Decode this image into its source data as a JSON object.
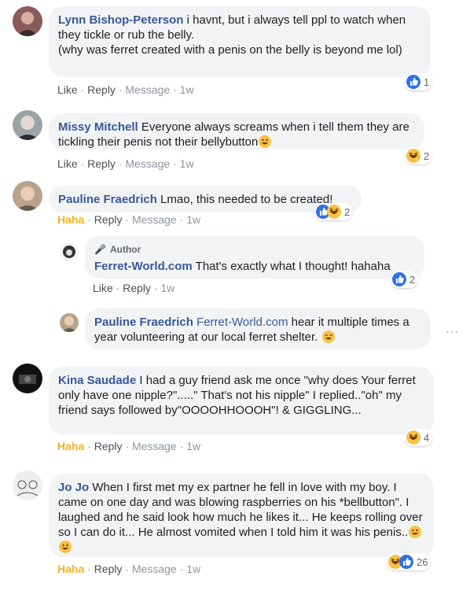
{
  "comments": [
    {
      "name": "Lynn Bishop-Peterson",
      "text": "i havnt, but i always tell ppl to watch when they tickle or rub the belly.\n(why was ferret created with a penis on the belly is beyond me lol)",
      "actions": [
        "Like",
        "Reply",
        "Message",
        "1w"
      ],
      "reactions": {
        "icons": [
          "like"
        ],
        "count": "1"
      }
    },
    {
      "name": "Missy Mitchell",
      "text": "Everyone always screams when i tell them they are tickling their penis not their bellybutton",
      "trailing_emoji": "rofl-emoji",
      "actions": [
        "Like",
        "Reply",
        "Message",
        "1w"
      ],
      "reactions": {
        "icons": [
          "haha"
        ],
        "count": "2"
      }
    },
    {
      "name": "Pauline Fraedrich",
      "text": "Lmao, this needed to be created!",
      "actions": [
        "Haha",
        "Reply",
        "Message",
        "1w"
      ],
      "reactions": {
        "icons": [
          "like",
          "haha"
        ],
        "count": "2"
      },
      "replies": [
        {
          "badge": "Author",
          "name": "Ferret-World.com",
          "text": "That's exactly what I thought! hahaha",
          "actions": [
            "Like",
            "Reply",
            "1w"
          ],
          "reactions": {
            "icons": [
              "like"
            ],
            "count": "2"
          }
        },
        {
          "name": "Pauline Fraedrich",
          "mention": "Ferret-World.com",
          "text": "hear it multiple times a year volunteering at our local ferret shelter.",
          "trailing_emoji": "grin-emoji",
          "more": "···"
        }
      ]
    },
    {
      "name": "Kina Saudade",
      "text": "I had a guy friend ask me once \"why does Your ferret only have one nipple?\".....\" That's not his nipple\" I replied..\"oh\" my friend says followed by\"OOOOHHOOOH\"! & GIGGLING...",
      "actions": [
        "Haha",
        "Reply",
        "Message",
        "1w"
      ],
      "reactions": {
        "icons": [
          "haha"
        ],
        "count": "4"
      }
    },
    {
      "name": "Jo Jo",
      "text": "When I first met my ex partner he fell in love with my boy. I came on one day and was blowing raspberries on his *bellbutton\". I laughed and he said look how much he likes it... He keeps rolling over so I can do it... He almost vomited when I told him it was his penis..",
      "trailing_emojis": [
        "laughing-emoji",
        "laughing-emoji"
      ],
      "actions": [
        "Haha",
        "Reply",
        "Message",
        "1w"
      ],
      "reactions": {
        "icons": [
          "haha",
          "like"
        ],
        "count": "26"
      }
    }
  ],
  "colors": {
    "link": "#385898",
    "haha": "#f7b125",
    "like": "#2f72e3",
    "bubble": "#f2f3f5"
  },
  "separator": "·"
}
